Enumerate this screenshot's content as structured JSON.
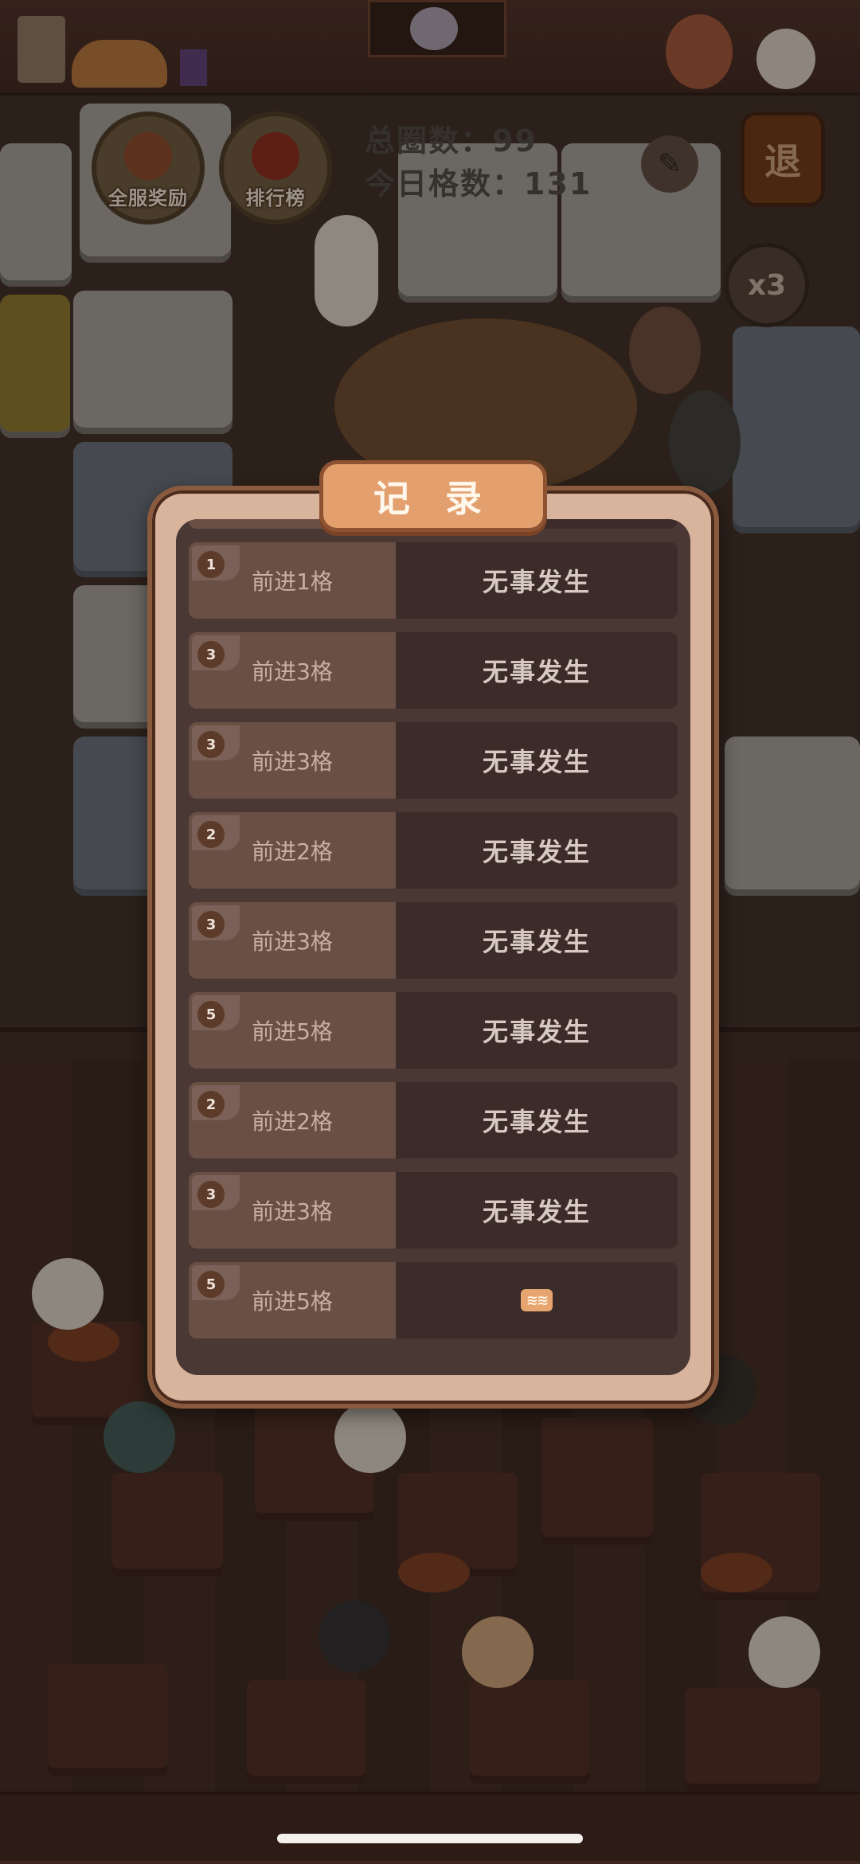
{
  "hud": {
    "rewards_label": "全服奖励",
    "ranking_label": "排行榜",
    "total_laps_label": "总圈数：",
    "total_laps_value": "99",
    "today_cells_label": "今日格数：",
    "today_cells_value": "131",
    "exit_label": "退",
    "speed_label": "x3"
  },
  "modal": {
    "title": "记 录",
    "rows": [
      {
        "dice": "2",
        "move": "前进2格",
        "result": "",
        "result_icon": "wave-icon"
      },
      {
        "dice": "1",
        "move": "前进1格",
        "result": "无事发生"
      },
      {
        "dice": "3",
        "move": "前进3格",
        "result": "无事发生"
      },
      {
        "dice": "3",
        "move": "前进3格",
        "result": "无事发生"
      },
      {
        "dice": "2",
        "move": "前进2格",
        "result": "无事发生"
      },
      {
        "dice": "3",
        "move": "前进3格",
        "result": "无事发生"
      },
      {
        "dice": "5",
        "move": "前进5格",
        "result": "无事发生"
      },
      {
        "dice": "2",
        "move": "前进2格",
        "result": "无事发生"
      },
      {
        "dice": "3",
        "move": "前进3格",
        "result": "无事发生"
      },
      {
        "dice": "5",
        "move": "前进5格",
        "result": "",
        "result_icon": "wave-icon"
      }
    ]
  },
  "colors": {
    "modal_frame": "#d9b49c",
    "modal_inner": "#4a3835",
    "title_bg": "#e3a06e",
    "row_left": "#6a4f45",
    "row_right": "#3b2c29"
  }
}
